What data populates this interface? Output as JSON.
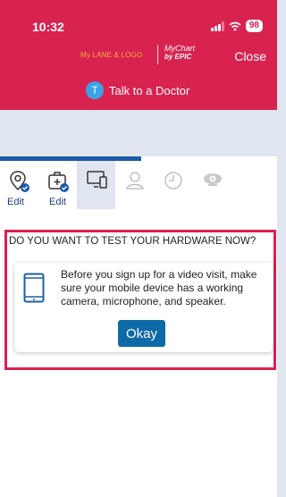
{
  "status_bar": {
    "time": "10:32",
    "battery": "98"
  },
  "header": {
    "logo_left_text": "My LANE & LOGO",
    "logo_right_line1": "MyChart",
    "logo_right_line2": "by EPIC",
    "close_label": "Close",
    "talk_avatar_letter": "T",
    "talk_label": "Talk to a Doctor"
  },
  "progress": {
    "fraction": 0.51
  },
  "steps": [
    {
      "icon": "location-check-icon",
      "label": "Edit",
      "state": "done"
    },
    {
      "icon": "medical-kit-check-icon",
      "label": "Edit",
      "state": "done"
    },
    {
      "icon": "device-icon",
      "label": "",
      "state": "active"
    },
    {
      "icon": "person-icon",
      "label": "",
      "state": "pending"
    },
    {
      "icon": "clock-icon",
      "label": "",
      "state": "pending"
    },
    {
      "icon": "webcam-icon",
      "label": "",
      "state": "pending"
    }
  ],
  "hardware": {
    "question": "DO YOU WANT TO TEST YOUR HARDWARE NOW?",
    "message": "Before you sign up for a video visit, make sure your mobile device has a working camera, microphone, and speaker.",
    "button_label": "Okay"
  },
  "colors": {
    "brand_red": "#d8224f",
    "primary_blue": "#0d6aa6",
    "nav_blue": "#1f3e7c",
    "light_band": "#dfe6ef"
  }
}
